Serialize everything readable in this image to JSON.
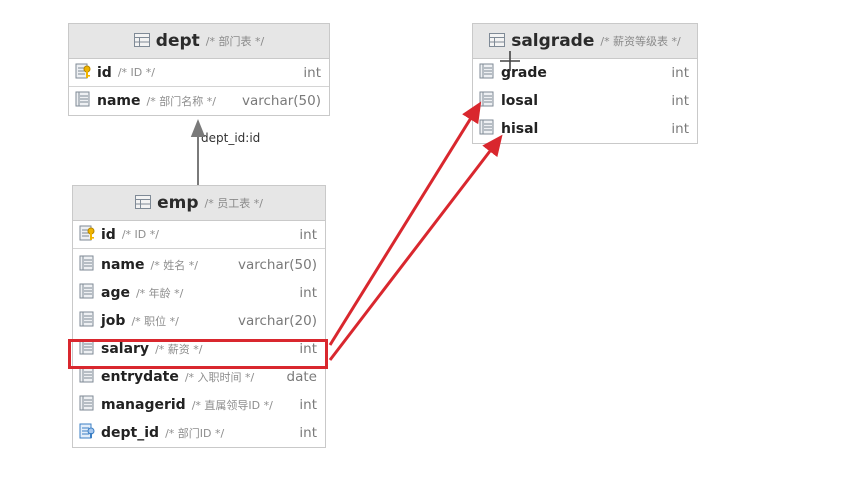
{
  "dept": {
    "title": "dept",
    "comment": "/* 部门表 */",
    "columns": [
      {
        "name": "id",
        "comment": "/* ID */",
        "type": "int",
        "key": "primary"
      },
      {
        "name": "name",
        "comment": "/* 部门名称 */",
        "type": "varchar(50)",
        "key": "none"
      }
    ]
  },
  "emp": {
    "title": "emp",
    "comment": "/* 员工表 */",
    "columns": [
      {
        "name": "id",
        "comment": "/* ID */",
        "type": "int",
        "key": "primary"
      },
      {
        "name": "name",
        "comment": "/* 姓名 */",
        "type": "varchar(50)",
        "key": "none"
      },
      {
        "name": "age",
        "comment": "/* 年龄 */",
        "type": "int",
        "key": "none"
      },
      {
        "name": "job",
        "comment": "/* 职位 */",
        "type": "varchar(20)",
        "key": "none"
      },
      {
        "name": "salary",
        "comment": "/* 薪资 */",
        "type": "int",
        "key": "none"
      },
      {
        "name": "entrydate",
        "comment": "/* 入职时间 */",
        "type": "date",
        "key": "none"
      },
      {
        "name": "managerid",
        "comment": "/* 直属领导ID */",
        "type": "int",
        "key": "none"
      },
      {
        "name": "dept_id",
        "comment": "/* 部门ID */",
        "type": "int",
        "key": "foreign"
      }
    ]
  },
  "salgrade": {
    "title": "salgrade",
    "comment": "/* 薪资等级表 */",
    "columns": [
      {
        "name": "grade",
        "comment": "",
        "type": "int",
        "key": "none"
      },
      {
        "name": "losal",
        "comment": "",
        "type": "int",
        "key": "none"
      },
      {
        "name": "hisal",
        "comment": "",
        "type": "int",
        "key": "none"
      }
    ]
  },
  "relation": {
    "label": "dept_id:id"
  },
  "colors": {
    "highlight": "#d9272e",
    "header_bg": "#e6e6e6",
    "border": "#c9c9c9",
    "relation_line": "#7a7a7a"
  },
  "icons": {
    "table": "table-icon",
    "column": "column-icon",
    "primary_key": "primary-key-icon",
    "foreign_key": "foreign-key-icon"
  }
}
